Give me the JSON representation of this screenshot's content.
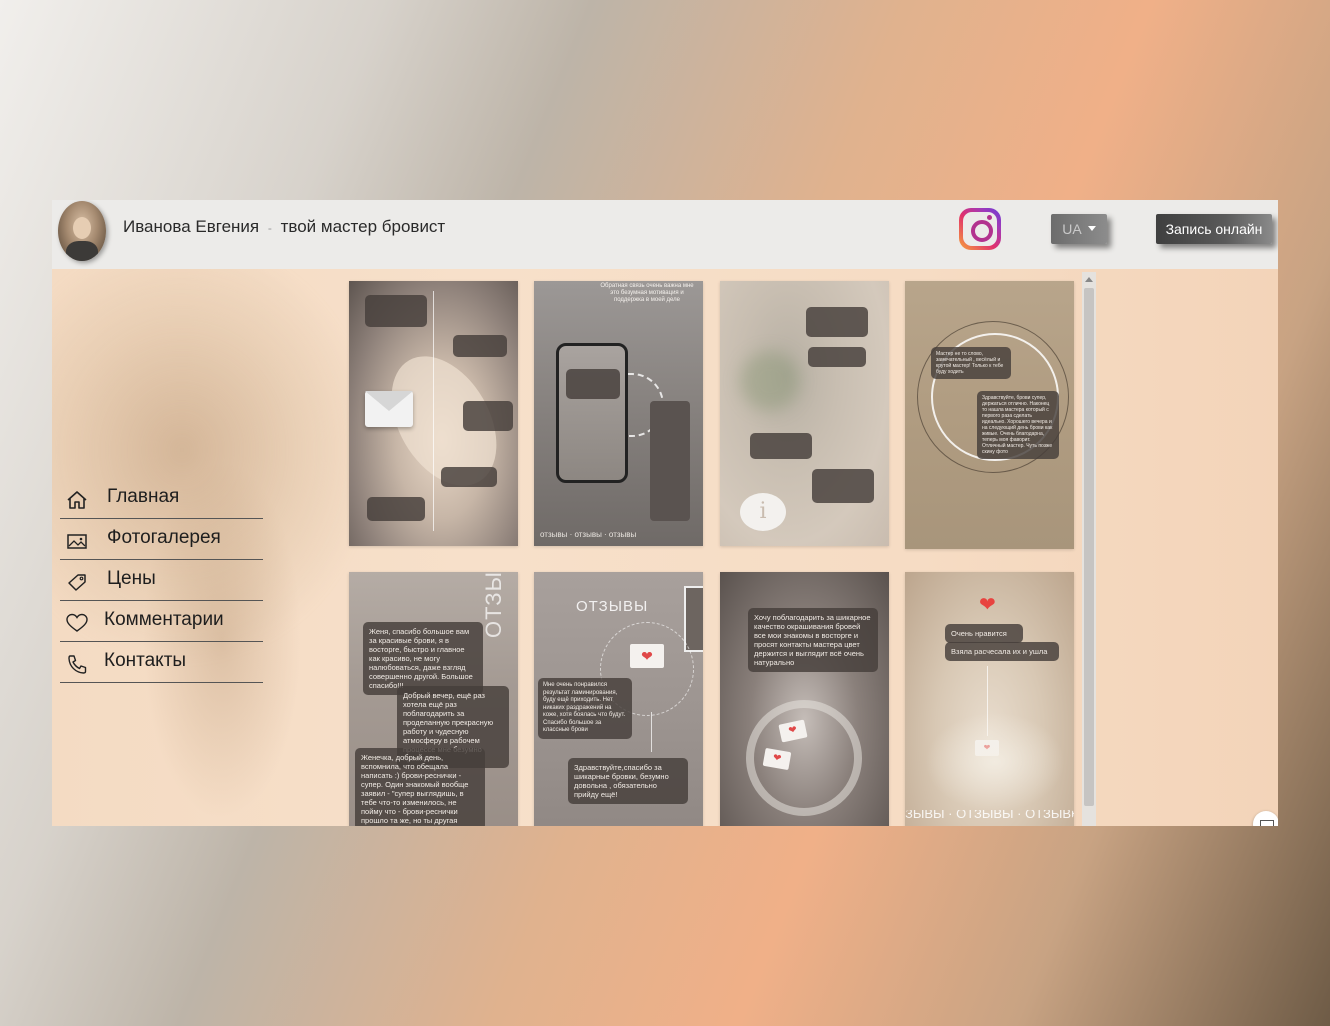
{
  "header": {
    "name": "Иванова Евгения",
    "separator": "-",
    "tagline": "твой мастер бровист",
    "language": "UA",
    "book_button": "Запись онлайн"
  },
  "nav": [
    {
      "label": "Главная",
      "icon": "home-icon"
    },
    {
      "label": "Фотогалерея",
      "icon": "image-icon"
    },
    {
      "label": "Цены",
      "icon": "tag-icon"
    },
    {
      "label": "Комментарии",
      "icon": "heart-icon"
    },
    {
      "label": "Контакты",
      "icon": "phone-icon"
    }
  ],
  "gallery": {
    "card2_caption": "Обратная связь очень важна мне это безумная мотивация и поддержка в моей деле",
    "card2_bottom": "отзывы · отзывы · отзывы",
    "card4_bubble1": "Мастер не то слово, замечательный , весёлый и крутой мастер! Только к тебе буду ходить",
    "card4_bubble2": "Здравствуйте, брови супер, держаться отлично. Наконец то нашла мастера который с первого раза сделать идеально. Хорошего вечера и на следующий день брови как живые. Очень благодарна, теперь моя фаворит. Отличный мастер. Чуть позже скину фото",
    "card5_vertical": "ОТЗЫВЫ",
    "card5_bubble1": "Женя, спасибо большое вам за красивые брови, я в восторге, быстро и главное как красиво, не могу налюбоваться, даже взгляд совершенно другой. Большое спасибо!!!",
    "card5_bubble2": "Добрый вечер, ещё раз хотела ещё раз поблагодарить за проделанную прекрасную работу и чудесную атмосферу в рабочем процессе мне безумно нравится",
    "card5_bubble3": "Женечка, добрый день, вспомнила, что обещала написать :) брови-реснички - супер. Один знакомый вообще заявил - \"супер выглядишь, в тебе что-то изменилось, не пойму что - брови-реснички прошло та же, но ты другая",
    "card6_title": "ОТЗЫВЫ",
    "card6_bubble1": "Мне очень понравился результат ламинирования, буду ещё приходить. Нет никаких раздражений на коже, хотя боялась что будут. Спасибо большое за классные брови",
    "card6_bubble2": "Здравствуйте,спасибо за шикарные бровки, безумно довольна , обязательно прийду ещё!",
    "card7_bubble": "Хочу поблагодарить за шикарное качество окрашивания бровей все мои знакомы в восторге и просят контакты мастера цвет держится и выглядит всё очень натурально",
    "card8_bubble1": "Очень нравится",
    "card8_bubble2": "Взяла расчесала их и ушла",
    "card8_bottom": "ЗЫВЫ · ОТЗЫВЫ · ОТЗЫВЫ · ОТЗ"
  },
  "colors": {
    "accent_button": "#4a4a4a",
    "instagram": "#b2328e"
  }
}
